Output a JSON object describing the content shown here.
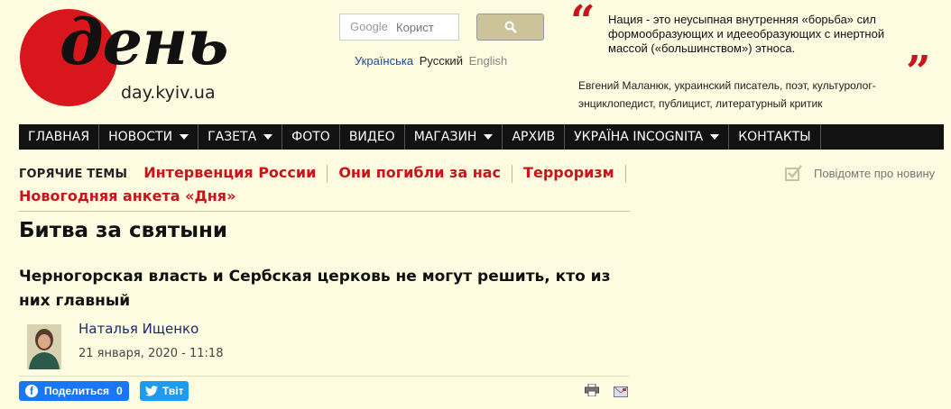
{
  "logo": {
    "word": "день",
    "site": "day.kyiv.ua"
  },
  "search": {
    "placeholder": "Корист",
    "google_label": "Google"
  },
  "languages": {
    "ua": "Українська",
    "ru": "Русский",
    "en": "English"
  },
  "quote": {
    "text": "Нация - это неусыпная внутренняя «борьба» сил формообразующих и идееобразующих с инертной массой («большинством») этноса.",
    "author": "Евгений Маланюк, украинский писатель, поэт, культуролог-энциклопедист, публицист, литературный критик"
  },
  "nav": [
    {
      "label": "ГЛАВНАЯ"
    },
    {
      "label": "НОВОСТИ"
    },
    {
      "label": "ГАЗЕТА"
    },
    {
      "label": "ФОТО"
    },
    {
      "label": "ВИДЕО"
    },
    {
      "label": "МАГАЗИН"
    },
    {
      "label": "АРХИВ"
    },
    {
      "label": "УКРАЇНА INCOGNITA"
    },
    {
      "label": "КОНТАКТЫ"
    }
  ],
  "hot_topics": {
    "label": "ГОРЯЧИЕ ТЕМЫ",
    "items": [
      "Интервенция России",
      "Они погибли за нас",
      "Терроризм",
      "Новогодняя анкета «Дня»"
    ]
  },
  "notify_label": "Повідомте про новину",
  "article": {
    "title": "Битва за святыни",
    "subtitle": "Черногорская власть и Сербская церковь не могут решить, кто из них главный",
    "author": "Наталья Ищенко",
    "date": "21 января, 2020 - 11:18"
  },
  "share": {
    "fb_label": "Поделиться",
    "fb_count": "0",
    "tw_label": "Твіт"
  },
  "colors": {
    "accent": "#c8151b",
    "background": "#fdfbe0",
    "nav_bg": "#121212"
  }
}
